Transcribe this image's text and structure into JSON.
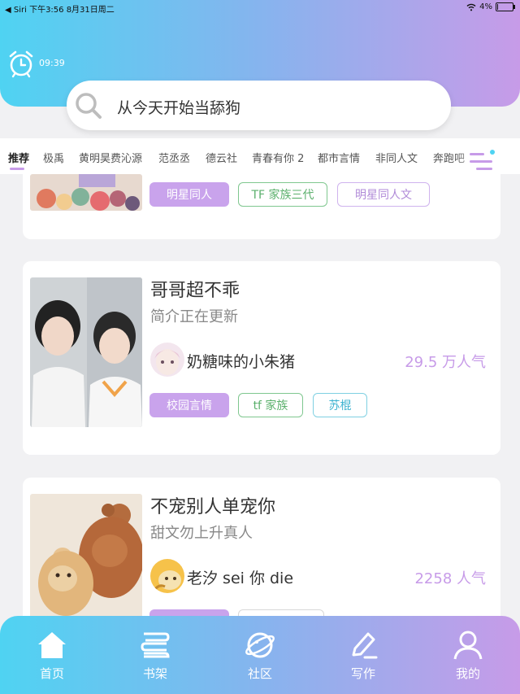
{
  "status_bar": {
    "left": "◀ Siri   下午3:56   8月31日周二",
    "battery": "4%"
  },
  "header": {
    "alarm_time": "09:39",
    "search_text": "从今天开始当舔狗"
  },
  "tabs": [
    {
      "label": "推荐",
      "active": true
    },
    {
      "label": "极禹"
    },
    {
      "label": "黄明昊费沁源"
    },
    {
      "label": "范丞丞"
    },
    {
      "label": "德云社"
    },
    {
      "label": "青春有你 2"
    },
    {
      "label": "都市言情"
    },
    {
      "label": "非同人文"
    },
    {
      "label": "奔跑吧"
    }
  ],
  "cards": [
    {
      "tags": [
        "明星同人",
        "TF 家族三代",
        "明星同人文"
      ]
    },
    {
      "title": "哥哥超不乖",
      "intro": "简介正在更新",
      "author": "奶糖味的小朱猪",
      "popularity": "29.5 万人气",
      "tags": [
        "校园言情",
        "tf 家族",
        "苏棍"
      ]
    },
    {
      "title": "不宠别人单宠你",
      "intro": "甜文勿上升真人",
      "author": "老汐 sei 你 die",
      "popularity": "2258 人气"
    }
  ],
  "bottom_nav": [
    {
      "label": "首页",
      "icon": "home-icon",
      "active": true
    },
    {
      "label": "书架",
      "icon": "bookshelf-icon"
    },
    {
      "label": "社区",
      "icon": "planet-icon"
    },
    {
      "label": "写作",
      "icon": "pen-icon"
    },
    {
      "label": "我的",
      "icon": "user-icon"
    }
  ],
  "colors": {
    "gradient_start": "#4fd3f2",
    "gradient_end": "#c79be8",
    "accent_purple": "#c79be8",
    "page_bg": "#f1f1f3"
  }
}
